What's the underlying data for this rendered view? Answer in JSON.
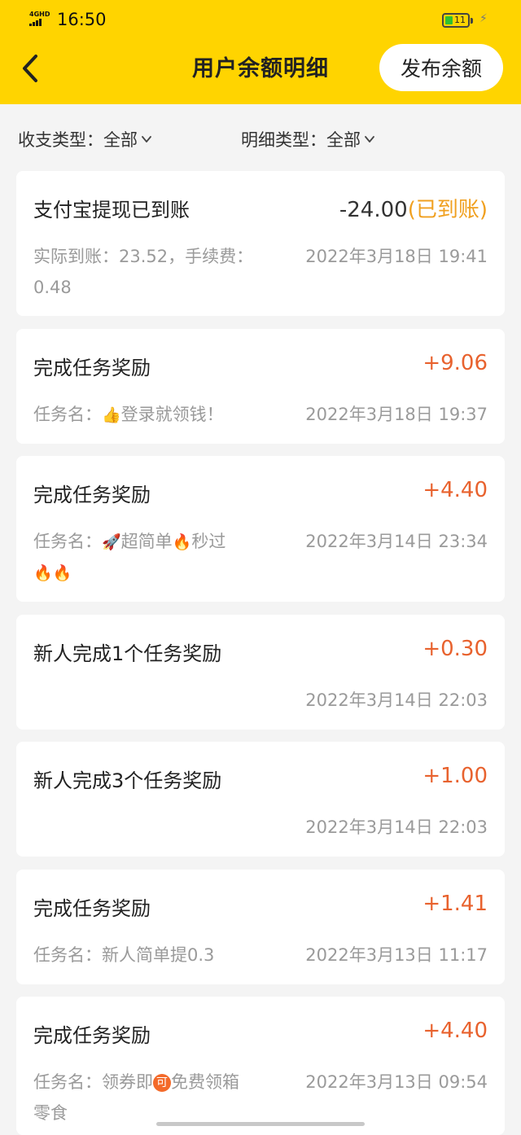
{
  "status_bar": {
    "network": "4GHD",
    "time": "16:50",
    "battery_level": "11",
    "battery_color": "#2fc12f"
  },
  "header": {
    "title": "用户余额明细",
    "back_icon": "chevron-left-icon",
    "publish_button": "发布余额",
    "background": "#ffd400"
  },
  "filters": {
    "income_type_label": "收支类型：",
    "income_type_value": "全部",
    "detail_type_label": "明细类型：",
    "detail_type_value": "全部"
  },
  "records": [
    {
      "title": "支付宝提现已到账",
      "amount": "-24.00",
      "status": "(已到账)",
      "detail_line1": "实际到账：23.52，手续费：",
      "detail_line2": "0.48",
      "time": "2022年3月18日 19:41"
    },
    {
      "title": "完成任务奖励",
      "amount": "+9.06",
      "detail_prefix": "任务名：",
      "detail_emoji": "👍",
      "detail_text": "登录就领钱！",
      "time": "2022年3月18日 19:37"
    },
    {
      "title": "完成任务奖励",
      "amount": "+4.40",
      "detail_prefix": "任务名：",
      "detail_emoji1": "🚀",
      "detail_text1": "超简单",
      "detail_emoji2": "🔥",
      "detail_text2": "秒过",
      "detail_line2": "🔥🔥",
      "time": "2022年3月14日 23:34"
    },
    {
      "title": "新人完成1个任务奖励",
      "amount": "+0.30",
      "time": "2022年3月14日 22:03"
    },
    {
      "title": "新人完成3个任务奖励",
      "amount": "+1.00",
      "time": "2022年3月14日 22:03"
    },
    {
      "title": "完成任务奖励",
      "amount": "+1.41",
      "detail_prefix": "任务名：",
      "detail_text": "新人简单提0.3",
      "time": "2022年3月13日 11:17"
    },
    {
      "title": "完成任务奖励",
      "amount": "+4.40",
      "detail_prefix": "任务名：",
      "detail_text1": "领券即",
      "detail_badge": "可",
      "detail_text2": "免费领箱",
      "detail_line2": "零食",
      "time": "2022年3月13日 09:54"
    }
  ],
  "colors": {
    "income": "#e8622e",
    "status_arrived": "#f0a020",
    "muted": "#9a9a9a"
  }
}
